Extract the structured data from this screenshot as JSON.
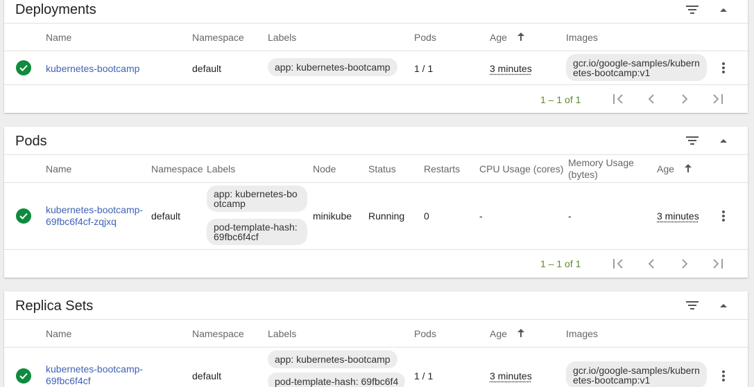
{
  "deployments": {
    "title": "Deployments",
    "headers": {
      "name": "Name",
      "namespace": "Namespace",
      "labels": "Labels",
      "pods": "Pods",
      "age": "Age",
      "images": "Images"
    },
    "row": {
      "name": "kubernetes-bootcamp",
      "namespace": "default",
      "label": "app: kubernetes-bootcamp",
      "pods": "1 / 1",
      "age": "3 minutes",
      "image": "gcr.io/google-samples/kubernetes-bootcamp:v1"
    },
    "pager": "1 – 1 of 1"
  },
  "pods": {
    "title": "Pods",
    "headers": {
      "name": "Name",
      "namespace": "Namespace",
      "labels": "Labels",
      "node": "Node",
      "status": "Status",
      "restarts": "Restarts",
      "cpu": "CPU Usage (cores)",
      "memory": "Memory Usage (bytes)",
      "age": "Age"
    },
    "row": {
      "name": "kubernetes-bootcamp-69fbc6f4cf-zqjxq",
      "namespace": "default",
      "label1": "app: kubernetes-bootcamp",
      "label2": "pod-template-hash: 69fbc6f4cf",
      "node": "minikube",
      "status": "Running",
      "restarts": "0",
      "cpu": "-",
      "memory": "-",
      "age": "3 minutes"
    },
    "pager": "1 – 1 of 1"
  },
  "replicasets": {
    "title": "Replica Sets",
    "headers": {
      "name": "Name",
      "namespace": "Namespace",
      "labels": "Labels",
      "pods": "Pods",
      "age": "Age",
      "images": "Images"
    },
    "row": {
      "name": "kubernetes-bootcamp-69fbc6f4cf",
      "namespace": "default",
      "label1": "app: kubernetes-bootcamp",
      "label2": "pod-template-hash: 69fbc6f4",
      "pods": "1 / 1",
      "age": "3 minutes",
      "image": "gcr.io/google-samples/kubernetes-bootcamp:v1"
    }
  },
  "icons": {
    "filter": "filter-icon",
    "collapse": "chevron-up-icon",
    "status": "check-circle-icon",
    "menu": "more-vert-icon",
    "sort": "arrow-up-icon",
    "first": "first-page-icon",
    "prev": "chevron-left-icon",
    "next": "chevron-right-icon",
    "last": "last-page-icon"
  },
  "colors": {
    "link": "#3f62b4",
    "success": "#0f8a3e",
    "pager": "#5b8a2a"
  }
}
